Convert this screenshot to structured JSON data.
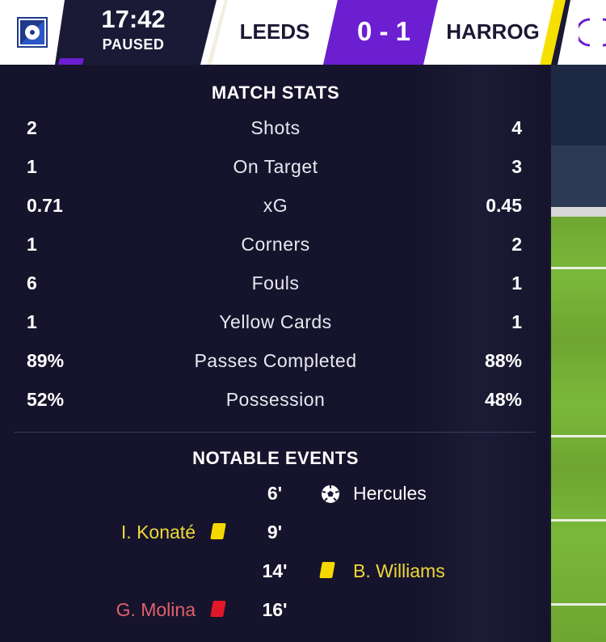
{
  "header": {
    "clock": "17:42",
    "status": "PAUSED",
    "home_team": "LEEDS",
    "score": "0 - 1",
    "away_team": "HARROG"
  },
  "colors": {
    "accent_purple": "#6b1fd1",
    "yellow_card": "#f5d800",
    "red_card": "#e0182a",
    "panel_bg": "#16142c"
  },
  "stats": {
    "title": "MATCH STATS",
    "rows": [
      {
        "label": "Shots",
        "home": "2",
        "away": "4"
      },
      {
        "label": "On Target",
        "home": "1",
        "away": "3"
      },
      {
        "label": "xG",
        "home": "0.71",
        "away": "0.45"
      },
      {
        "label": "Corners",
        "home": "1",
        "away": "2"
      },
      {
        "label": "Fouls",
        "home": "6",
        "away": "1"
      },
      {
        "label": "Yellow Cards",
        "home": "1",
        "away": "1"
      },
      {
        "label": "Passes Completed",
        "home": "89%",
        "away": "88%"
      },
      {
        "label": "Possession",
        "home": "52%",
        "away": "48%"
      }
    ]
  },
  "events": {
    "title": "NOTABLE EVENTS",
    "rows": [
      {
        "minute": "6'",
        "side": "away",
        "type": "goal",
        "icon": "football-icon",
        "player": "Hercules"
      },
      {
        "minute": "9'",
        "side": "home",
        "type": "yellow",
        "icon": "yellow-card-icon",
        "player": "I. Konaté"
      },
      {
        "minute": "14'",
        "side": "away",
        "type": "yellow",
        "icon": "yellow-card-icon",
        "player": "B. Williams"
      },
      {
        "minute": "16'",
        "side": "home",
        "type": "red",
        "icon": "red-card-icon",
        "player": "G. Molina"
      }
    ]
  }
}
